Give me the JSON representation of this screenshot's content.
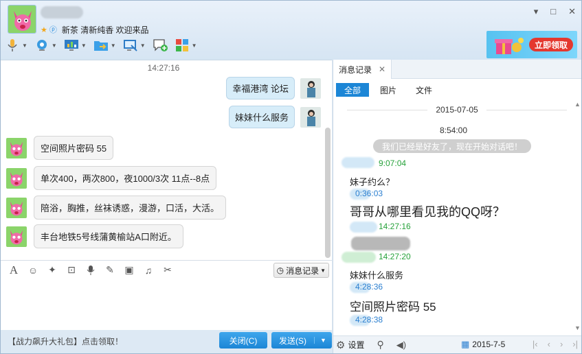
{
  "window": {
    "minimize": "▾",
    "restore": "□",
    "close": "✕"
  },
  "contact": {
    "signature": "新茶 清新纯香 欢迎来品"
  },
  "ad": {
    "label": "立即领取"
  },
  "chat": {
    "time": "14:27:16",
    "sent": [
      "幸福港湾 论坛",
      "妹妹什么服务"
    ],
    "received": [
      "空间照片密码  55",
      "单次400，两次800，夜1000/3次 11点--8点",
      "陪浴，胸推，丝袜诱惑，漫游，口活，大活。",
      "丰台地铁5号线蒲黄榆站A口附近。"
    ]
  },
  "input_toolbar": {
    "history_label": "消息记录"
  },
  "bottom": {
    "promo": "【战力飙升大礼包】点击领取！",
    "close_label": "关闭(C)",
    "send_label": "发送(S)"
  },
  "history": {
    "tab_label": "消息记录",
    "filters": [
      "全部",
      "图片",
      "文件"
    ],
    "date": "2015-07-05",
    "time_center": "8:54:00",
    "system_msg": "我们已经是好友了，现在开始对话吧！",
    "entries": [
      {
        "time": "9:07:04",
        "text": "妹子约么？"
      },
      {
        "time": "0:36:03",
        "text": "哥哥从哪里看见我的QQ呀？"
      },
      {
        "time": "14:27:16",
        "text": ""
      },
      {
        "time": "14:27:20",
        "text": "妹妹什么服务"
      },
      {
        "time": "4:28:36",
        "text": "空间照片密码  55"
      },
      {
        "time": "4:28:38",
        "text": ""
      }
    ],
    "settings_label": "设置",
    "bottom_date": "2015-7-5"
  }
}
